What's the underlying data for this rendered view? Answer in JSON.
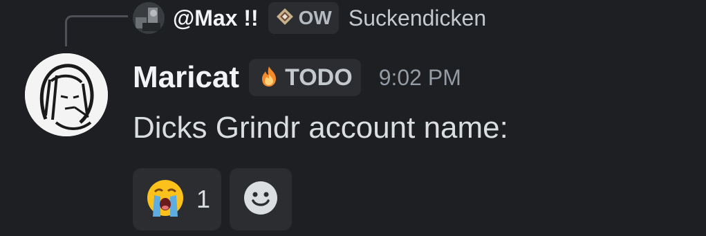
{
  "reply": {
    "username": "@Max !!",
    "tag": "OW",
    "content": "Suckendicken"
  },
  "message": {
    "username": "Maricat",
    "tag": "TODO",
    "timestamp": "9:02 PM",
    "content": "Dicks Grindr account name:"
  },
  "reactions": [
    {
      "emoji": "loudly-crying-face",
      "count": "1"
    }
  ],
  "icons": {
    "reply_tag_icon": "diamond-badge-icon",
    "tag_icon": "fire-icon",
    "add_reaction_icon": "smiley-icon"
  },
  "colors": {
    "background": "#1e1f22",
    "chip": "#2b2d31",
    "username": "#f2f3f5",
    "timestamp": "#949ba4"
  }
}
